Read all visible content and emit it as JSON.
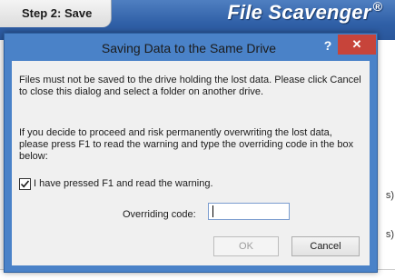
{
  "app": {
    "step_tab": "Step 2: Save",
    "brand": "File Scavenger",
    "brand_mark": "®",
    "side_marks": [
      "s)",
      "s)"
    ]
  },
  "dialog": {
    "title": "Saving Data to the Same Drive",
    "help_glyph": "?",
    "close_glyph": "✕",
    "message1": "Files must not be saved to the drive holding the lost data. Please click Cancel to close this dialog and select a folder on another drive.",
    "message2": "If you decide to proceed and risk permanently overwriting the lost data, please press F1 to read the warning and type the overriding code in the box below:",
    "checkbox_label": "I have pressed F1 and read the warning.",
    "checkbox_checked": true,
    "code_label": "Overriding code:",
    "code_value": "",
    "ok_label": "OK",
    "cancel_label": "Cancel"
  },
  "colors": {
    "titlebar": "#4a82c8",
    "close": "#c7443a",
    "header": "#2f5fa6"
  }
}
